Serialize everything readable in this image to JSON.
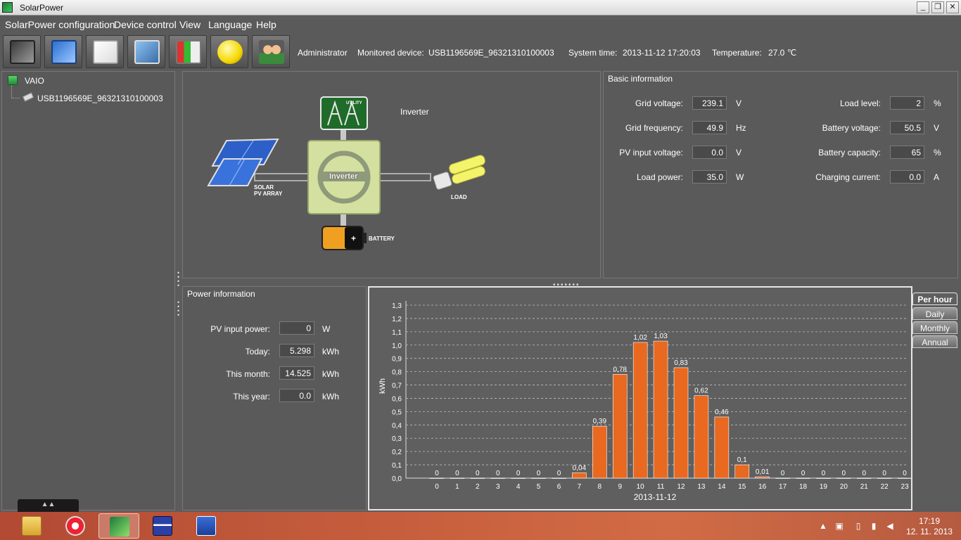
{
  "window": {
    "title": "SolarPower"
  },
  "menu": [
    "SolarPower configuration",
    "Device control",
    "View",
    "Language",
    "Help"
  ],
  "status": {
    "user": "Administrator",
    "device_label": "Monitored device:",
    "device_id": "USB1196569E_96321310100003",
    "time_label": "System time:",
    "time": "2013-11-12 17:20:03",
    "temp_label": "Temperature:",
    "temp": "27.0 ℃"
  },
  "tree": {
    "root": "VAIO",
    "child": "USB1196569E_96321310100003"
  },
  "diagram": {
    "inverter_label": "Inverter",
    "inverter_box": "Inverter",
    "utility": "UTILITY",
    "solar_line1": "SOLAR",
    "solar_line2": "PV ARRAY",
    "load": "LOAD",
    "battery": "BATTERY"
  },
  "basic": {
    "title": "Basic information",
    "left": [
      {
        "label": "Grid voltage:",
        "value": "239.1",
        "unit": "V"
      },
      {
        "label": "Grid frequency:",
        "value": "49.9",
        "unit": "Hz"
      },
      {
        "label": "PV input voltage:",
        "value": "0.0",
        "unit": "V"
      },
      {
        "label": "Load power:",
        "value": "35.0",
        "unit": "W"
      }
    ],
    "right": [
      {
        "label": "Load level:",
        "value": "2",
        "unit": "%"
      },
      {
        "label": "Battery voltage:",
        "value": "50.5",
        "unit": "V"
      },
      {
        "label": "Battery capacity:",
        "value": "65",
        "unit": "%"
      },
      {
        "label": "Charging current:",
        "value": "0.0",
        "unit": "A"
      }
    ]
  },
  "power": {
    "title": "Power information",
    "rows": [
      {
        "label": "PV input power:",
        "value": "0",
        "unit": "W"
      },
      {
        "label": "Today:",
        "value": "5.298",
        "unit": "kWh"
      },
      {
        "label": "This month:",
        "value": "14.525",
        "unit": "kWh"
      },
      {
        "label": "This year:",
        "value": "0.0",
        "unit": "kWh"
      }
    ]
  },
  "tabs": [
    "Per hour",
    "Daily",
    "Monthly",
    "Annual"
  ],
  "chart_data": {
    "type": "bar",
    "categories": [
      "0",
      "1",
      "2",
      "3",
      "4",
      "5",
      "6",
      "7",
      "8",
      "9",
      "10",
      "11",
      "12",
      "13",
      "14",
      "15",
      "16",
      "17",
      "18",
      "19",
      "20",
      "21",
      "22",
      "23"
    ],
    "values": [
      0,
      0,
      0,
      0,
      0,
      0,
      0,
      0.04,
      0.39,
      0.78,
      1.02,
      1.03,
      0.83,
      0.62,
      0.46,
      0.1,
      0.01,
      0,
      0,
      0,
      0,
      0,
      0,
      0
    ],
    "value_labels": [
      "0",
      "0",
      "0",
      "0",
      "0",
      "0",
      "0",
      "0,04",
      "0,39",
      "0,78",
      "1,02",
      "1,03",
      "0,83",
      "0,62",
      "0,46",
      "0,1",
      "0,01",
      "0",
      "0",
      "0",
      "0",
      "0",
      "0",
      "0"
    ],
    "yticks": [
      "0,0",
      "0,1",
      "0,2",
      "0,3",
      "0,4",
      "0,5",
      "0,6",
      "0,7",
      "0,8",
      "0,9",
      "1,0",
      "1,1",
      "1,2",
      "1,3"
    ],
    "ylim": [
      0,
      1.3
    ],
    "ylabel": "kWh",
    "xlabel": "2013-11-12",
    "bar_color": "#e8691f",
    "grid": true
  },
  "clock": {
    "time": "17:19",
    "date": "12. 11. 2013"
  }
}
